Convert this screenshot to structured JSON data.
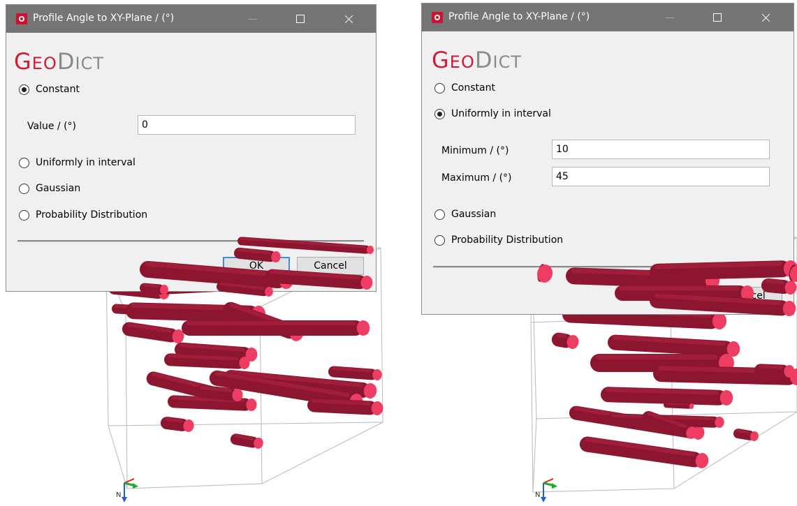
{
  "left_dialog": {
    "title": "Profile Angle to XY-Plane / (°)",
    "logo": {
      "first_letter": "G",
      "first_rest": "EO",
      "second_letter": "D",
      "second_rest": "ICT"
    },
    "options": {
      "constant": "Constant",
      "uniform": "Uniformly in interval",
      "gaussian": "Gaussian",
      "probability": "Probability Distribution"
    },
    "selected_option": "Constant",
    "value_label": "Value / (°)",
    "value": "0",
    "ok_label": "OK",
    "cancel_label": "Cancel"
  },
  "right_dialog": {
    "title": "Profile Angle to XY-Plane / (°)",
    "logo": {
      "first_letter": "G",
      "first_rest": "EO",
      "second_letter": "D",
      "second_rest": "ICT"
    },
    "options": {
      "constant": "Constant",
      "uniform": "Uniformly in interval",
      "gaussian": "Gaussian",
      "probability": "Probability Distribution"
    },
    "selected_option": "Uniformly in interval",
    "minimum_label": "Minimum / (°)",
    "minimum_value": "10",
    "maximum_label": "Maximum / (°)",
    "maximum_value": "45",
    "cancel_label": "Cancel"
  },
  "axes": {
    "z_label": "N"
  },
  "colors": {
    "titlebar": "#757575",
    "dialog_bg": "#f0f0f0",
    "brand_red": "#d11a37",
    "fiber_body": "#8c1530",
    "fiber_end": "#ee3d62",
    "bbox": "#b8b8b8",
    "axis_x": "#e02020",
    "axis_y": "#1faa2a",
    "axis_z": "#1f5fd6"
  }
}
